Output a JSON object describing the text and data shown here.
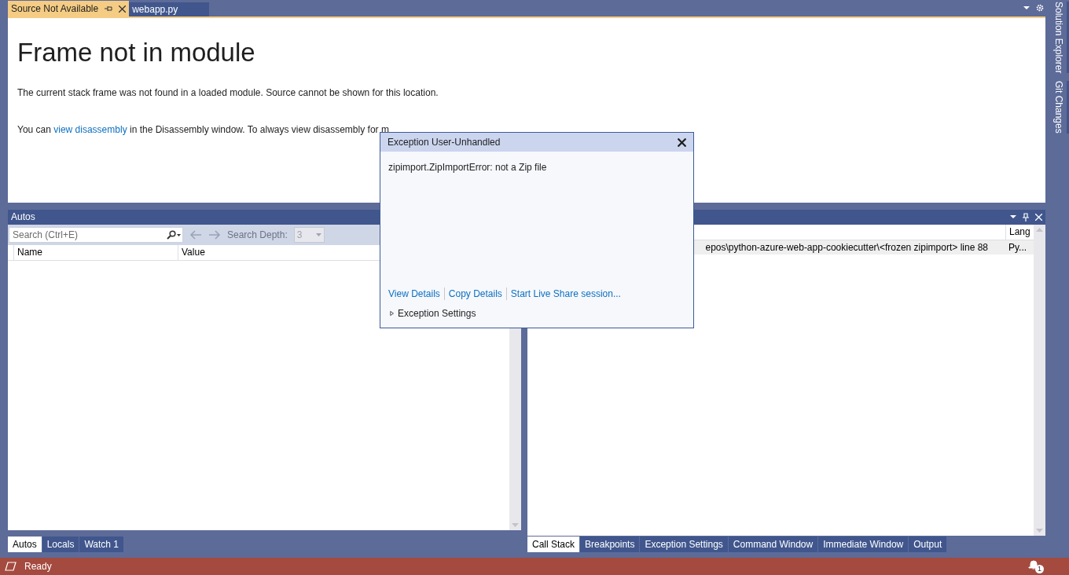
{
  "document_tabs": [
    {
      "label": "Source Not Available",
      "selected": true
    },
    {
      "label": "webapp.py",
      "selected": false
    }
  ],
  "side_tabs": [
    "Solution Explorer",
    "Git Changes"
  ],
  "document": {
    "heading": "Frame not in module",
    "message": "The current stack frame was not found in a loaded module. Source cannot be shown for this location.",
    "disassembly_note": {
      "before": "You can ",
      "link": "view disassembly",
      "after": " in the Disassembly window. To always view disassembly for m"
    }
  },
  "autos_panel": {
    "title": "Autos",
    "search": {
      "placeholder": "Search (Ctrl+E)"
    },
    "search_depth_label": "Search Depth:",
    "search_depth": {
      "value": "3",
      "disabled": true
    },
    "columns": [
      "Name",
      "Value"
    ],
    "tabs": [
      {
        "label": "Autos",
        "selected": true
      },
      {
        "label": "Locals",
        "selected": false
      },
      {
        "label": "Watch 1",
        "selected": false
      }
    ]
  },
  "call_stack_panel": {
    "columns": [
      "Lang"
    ],
    "rows": [
      {
        "column_1": "epos\\python-azure-web-app-cookiecutter\\<frozen zipimport> line 88",
        "lang": "Py...",
        "selected": true
      }
    ],
    "tabs": [
      {
        "label": "Call Stack",
        "selected": true
      },
      {
        "label": "Breakpoints",
        "selected": false
      },
      {
        "label": "Exception Settings",
        "selected": false
      },
      {
        "label": "Command Window",
        "selected": false
      },
      {
        "label": "Immediate Window",
        "selected": false
      },
      {
        "label": "Output",
        "selected": false
      }
    ]
  },
  "exception_dialog": {
    "title": "Exception User-Unhandled",
    "message": "zipimport.ZipImportError: not a Zip file",
    "links": [
      "View Details",
      "Copy Details",
      "Start Live Share session..."
    ],
    "settings": {
      "label": "Exception Settings",
      "expanded": false
    }
  },
  "status_bar": {
    "text": "Ready",
    "notifications": "1"
  }
}
